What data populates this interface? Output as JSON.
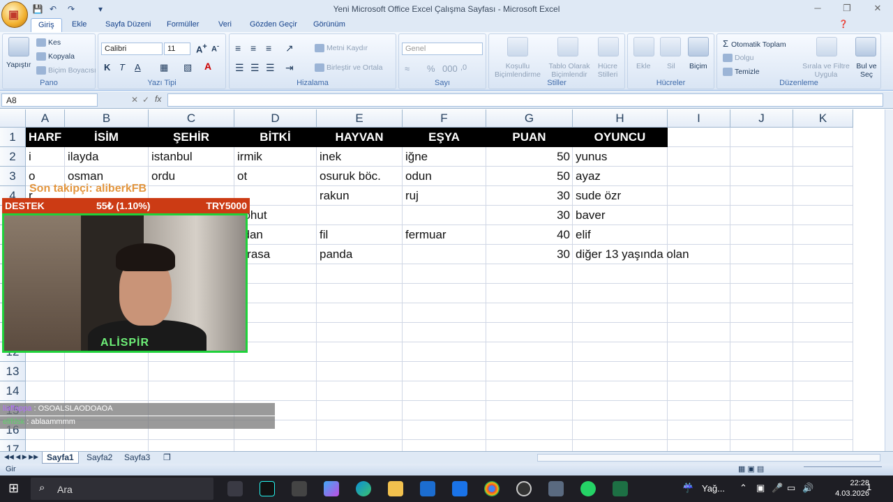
{
  "window": {
    "title": "Yeni Microsoft Office Excel Çalışma Sayfası - Microsoft Excel"
  },
  "ribbon_tabs": [
    "Giriş",
    "Ekle",
    "Sayfa Düzeni",
    "Formüller",
    "Veri",
    "Gözden Geçir",
    "Görünüm"
  ],
  "ribbon": {
    "pano": {
      "label": "Pano",
      "paste": "Yapıştır",
      "cut": "Kes",
      "copy": "Kopyala",
      "format_painter": "Biçim Boyacısı"
    },
    "font": {
      "label": "Yazı Tipi",
      "font_name": "Calibri",
      "font_size": "11"
    },
    "alignment": {
      "label": "Hizalama",
      "wrap": "Metni Kaydır",
      "merge": "Birleştir ve Ortala"
    },
    "number": {
      "label": "Sayı",
      "format": "Genel"
    },
    "styles": {
      "label": "Stiller",
      "conditional": "Koşullu Biçimlendirme",
      "table": "Tablo Olarak Biçimlendir",
      "cell_styles": "Hücre Stilleri"
    },
    "cells": {
      "label": "Hücreler",
      "insert": "Ekle",
      "delete": "Sil",
      "format": "Biçim"
    },
    "editing": {
      "label": "Düzenleme",
      "autosum": "Otomatik Toplam",
      "fill": "Dolgu",
      "clear": "Temizle",
      "sort": "Sırala ve Filtre Uygula",
      "find": "Bul ve Seç"
    }
  },
  "formula_bar": {
    "name_box": "A8",
    "fx": "fx"
  },
  "columns": [
    "A",
    "B",
    "C",
    "D",
    "E",
    "F",
    "G",
    "H",
    "I",
    "J",
    "K"
  ],
  "rows": [
    "1",
    "2",
    "3",
    "4",
    "5",
    "6",
    "7",
    "8",
    "9",
    "10",
    "11",
    "12",
    "13",
    "14",
    "15",
    "16",
    "17"
  ],
  "table": {
    "headers": [
      "HARF",
      "İSİM",
      "ŞEHİR",
      "BİTKİ",
      "HAYVAN",
      "EŞYA",
      "PUAN",
      "OYUNCU"
    ],
    "data": [
      [
        "i",
        "ilayda",
        "istanbul",
        "irmik",
        "inek",
        "iğne",
        "50",
        "yunus"
      ],
      [
        "o",
        "osman",
        "ordu",
        "ot",
        "osuruk böc.",
        "odun",
        "50",
        "ayaz"
      ],
      [
        "r",
        "",
        "",
        "",
        "rakun",
        "ruj",
        "30",
        "sude özr"
      ],
      [
        "",
        "",
        "",
        "nohut",
        "",
        "",
        "30",
        "baver"
      ],
      [
        "",
        "",
        "",
        "fidan",
        "fil",
        "fermuar",
        "40",
        "elif"
      ],
      [
        "",
        "",
        "",
        "pırasa",
        "panda",
        "",
        "30",
        "diğer 13 yaşında olan"
      ]
    ]
  },
  "stream_overlay": {
    "follower": "Son takipçi: aliberkFB",
    "donation_title": "DESTEK",
    "donation_amount": "55₺ (1.10%)",
    "donation_goal": "TRY5000",
    "streamer_name": "ALİSPİR",
    "chat": [
      {
        "user": "liaffappa",
        "message": "OSOALSLAODOAOA"
      },
      {
        "user": "elifdsk",
        "message": "ablaammmm"
      }
    ]
  },
  "sheet_tabs": [
    "Sayfa1",
    "Sayfa2",
    "Sayfa3"
  ],
  "status": {
    "mode": "Gir"
  },
  "taskbar": {
    "search_placeholder": "Ara",
    "weather": "Yağ...",
    "time": "22:28",
    "date": "4.03.2026",
    "notifications": "1"
  }
}
